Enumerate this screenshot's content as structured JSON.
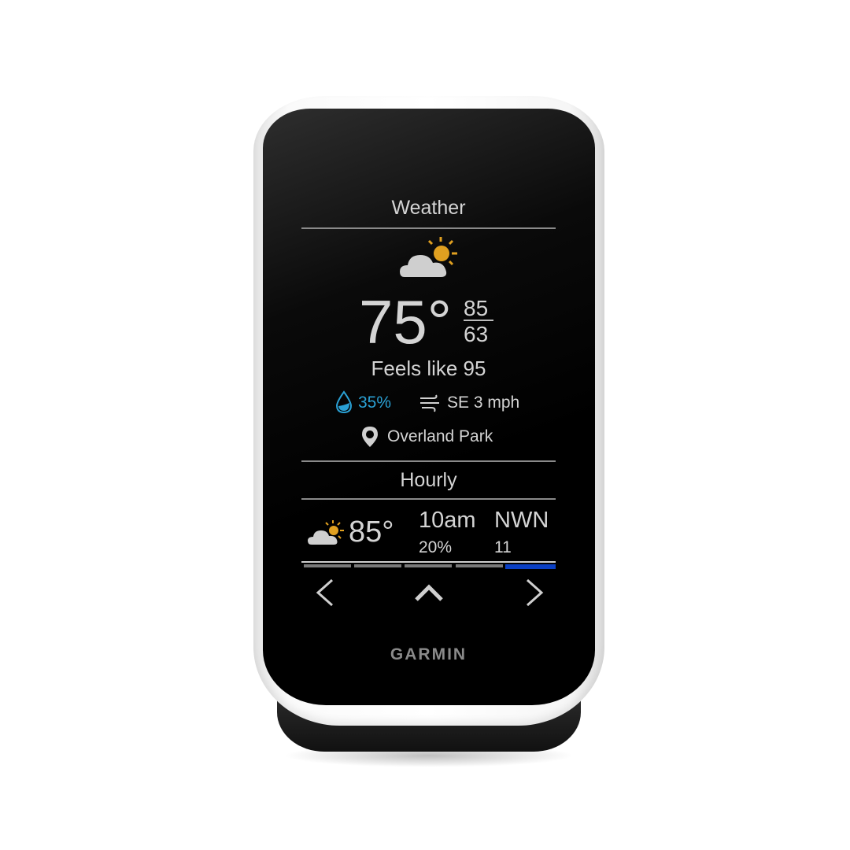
{
  "brand": "GARMIN",
  "weather": {
    "title": "Weather",
    "condition_icon": "partly-sunny-icon",
    "temperature": "75°",
    "high": "85",
    "low": "63",
    "feels_like": "Feels like 95",
    "precip_chance": "35%",
    "wind": "SE 3 mph",
    "location": "Overland Park"
  },
  "hourly": {
    "title": "Hourly",
    "condition_icon": "partly-sunny-icon",
    "temperature": "85°",
    "time": "10am",
    "precip_chance": "20%",
    "wind_direction": "NWN",
    "wind_speed": "11"
  },
  "pager": {
    "pages": 5,
    "active_page": 5
  },
  "colors": {
    "accent_blue": "#0a3fc4",
    "precip_blue": "#2aa0d4",
    "sun": "#e0a020"
  }
}
